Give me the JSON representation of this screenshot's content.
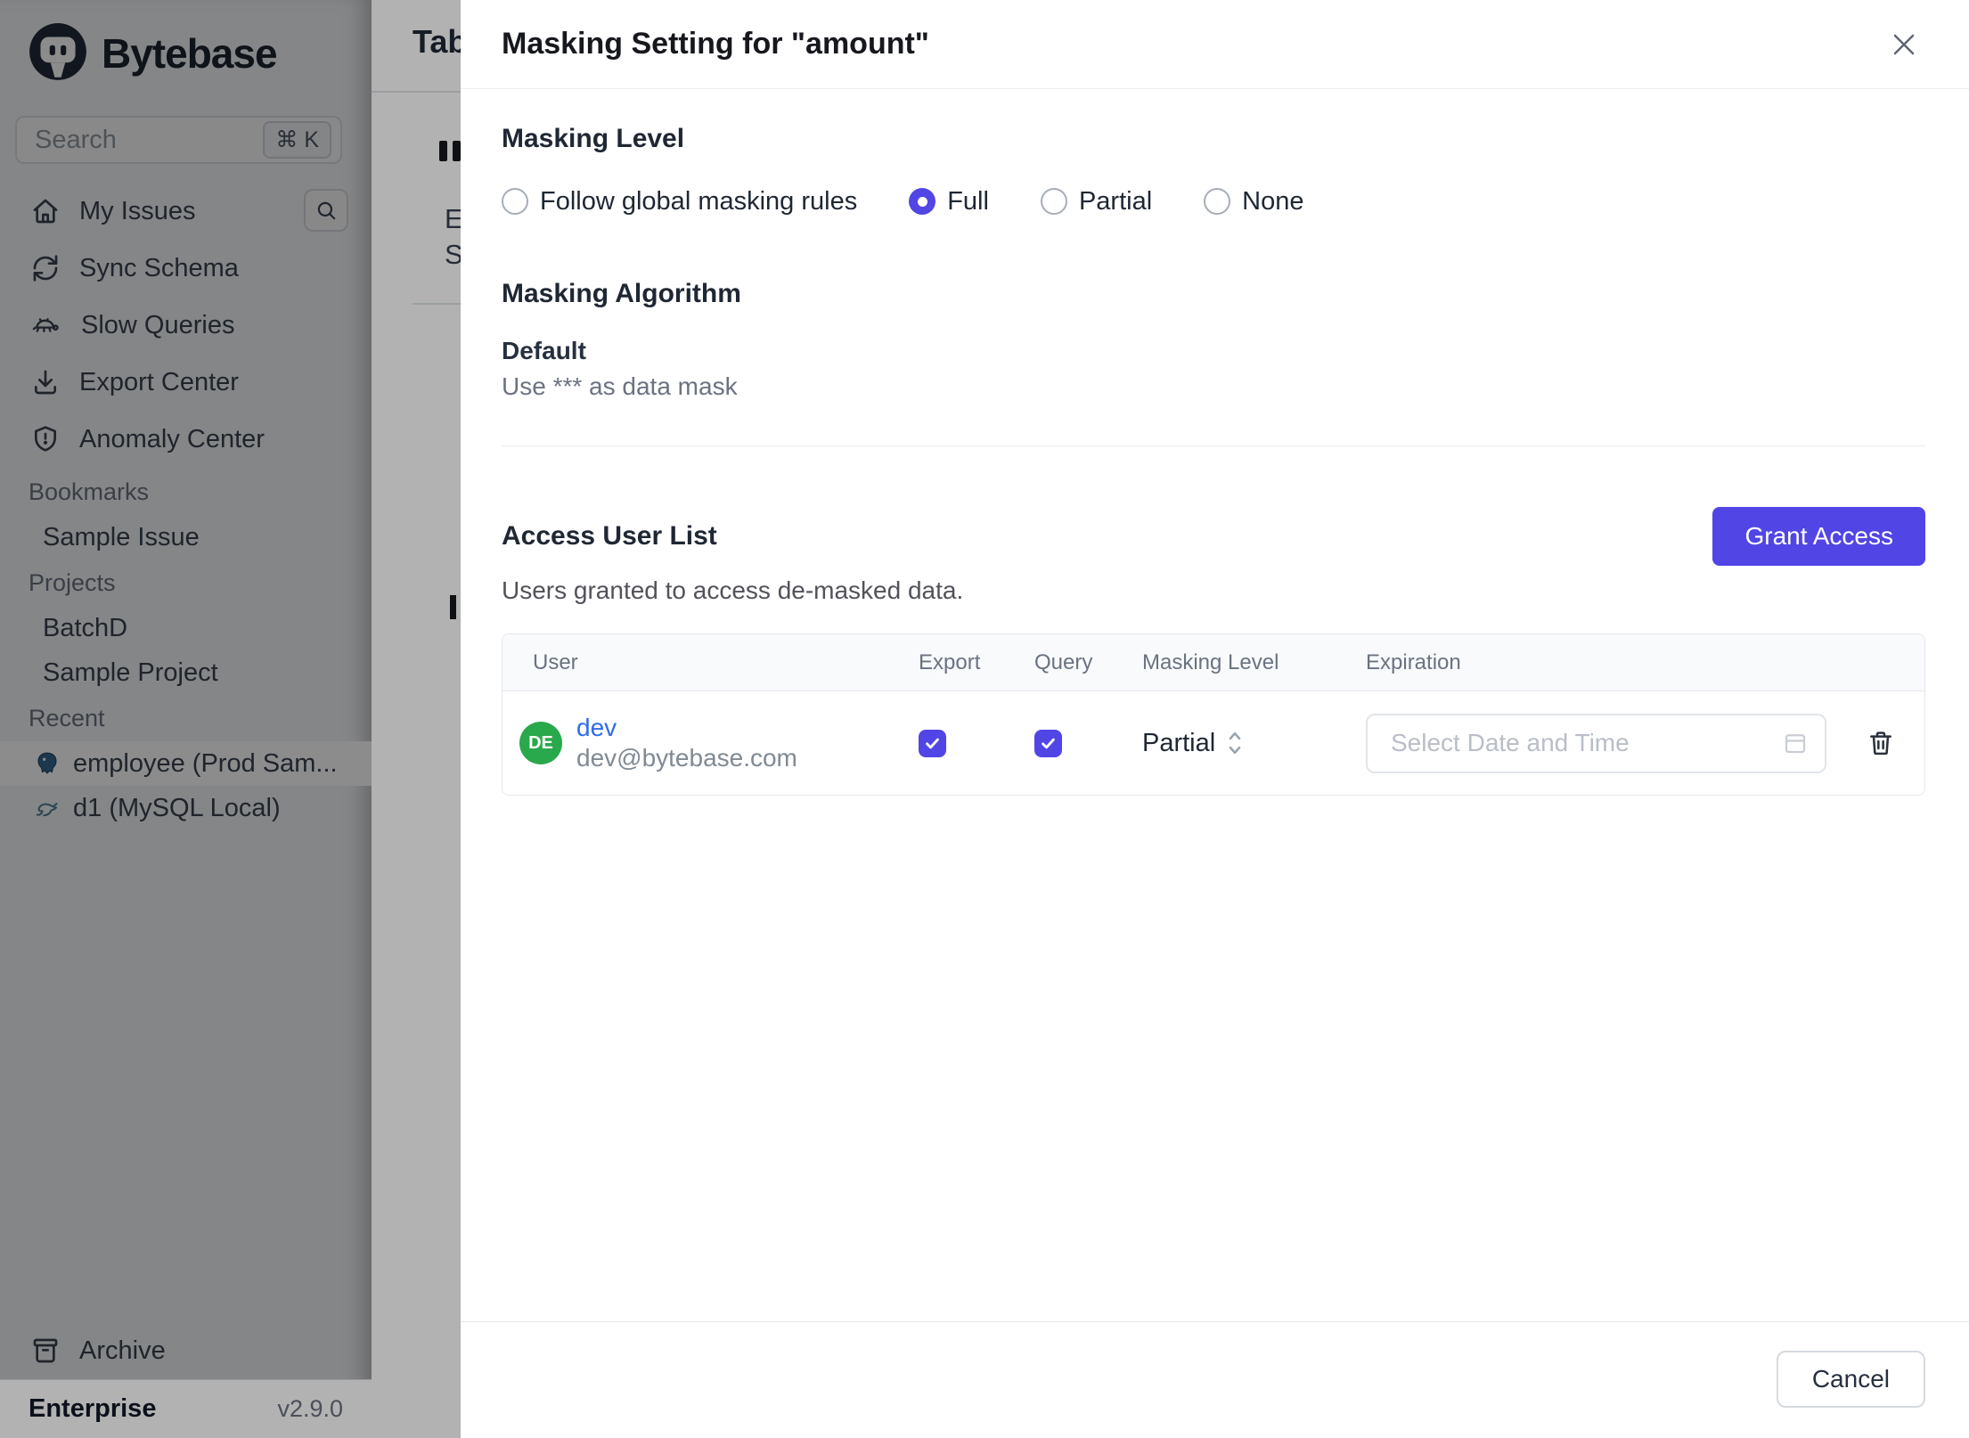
{
  "colors": {
    "accent": "#5145E5",
    "link_blue": "#2D6CEA",
    "avatar_green": "#2AA84C",
    "postgres_blue": "#336791",
    "mysql_teal": "#4D7F96",
    "dim_overlay": "rgba(0,0,0,0.45)"
  },
  "sidebar": {
    "logo_text": "Bytebase",
    "search": {
      "placeholder": "Search",
      "shortcut": "⌘ K"
    },
    "nav": [
      {
        "label": "My Issues",
        "icon": "home-icon"
      },
      {
        "label": "Sync Schema",
        "icon": "sync-icon"
      },
      {
        "label": "Slow Queries",
        "icon": "turtle-icon"
      },
      {
        "label": "Export Center",
        "icon": "download-icon"
      },
      {
        "label": "Anomaly Center",
        "icon": "shield-icon"
      }
    ],
    "sections": [
      {
        "label": "Bookmarks",
        "items": [
          {
            "label": "Sample Issue"
          }
        ]
      },
      {
        "label": "Projects",
        "items": [
          {
            "label": "BatchD"
          },
          {
            "label": "Sample Project"
          }
        ]
      },
      {
        "label": "Recent",
        "items": [
          {
            "label": "employee (Prod Sam...",
            "icon": "postgresql-icon",
            "selected": true
          },
          {
            "label": "d1 (MySQL Local)",
            "icon": "mysql-icon",
            "selected": false
          }
        ]
      }
    ],
    "archive_label": "Archive",
    "plan": "Enterprise",
    "version": "v2.9.0"
  },
  "background_page": {
    "tab_title_fragment": "Tab",
    "letter_fragments": [
      "E",
      "S"
    ]
  },
  "modal": {
    "title": "Masking Setting for \"amount\"",
    "masking_level": {
      "heading": "Masking Level",
      "options": [
        "Follow global masking rules",
        "Full",
        "Partial",
        "None"
      ],
      "selected": "Full"
    },
    "masking_algorithm": {
      "heading": "Masking Algorithm",
      "name": "Default",
      "description": "Use *** as data mask"
    },
    "access_user_list": {
      "heading": "Access User List",
      "subtitle": "Users granted to access de-masked data.",
      "grant_button": "Grant Access",
      "table": {
        "columns": [
          "User",
          "Export",
          "Query",
          "Masking Level",
          "Expiration"
        ],
        "rows": [
          {
            "avatar_initials": "DE",
            "name": "dev",
            "email": "dev@bytebase.com",
            "export_checked": true,
            "query_checked": true,
            "masking_level": "Partial",
            "expiration_placeholder": "Select Date and Time"
          }
        ]
      }
    },
    "footer": {
      "cancel_label": "Cancel"
    }
  }
}
